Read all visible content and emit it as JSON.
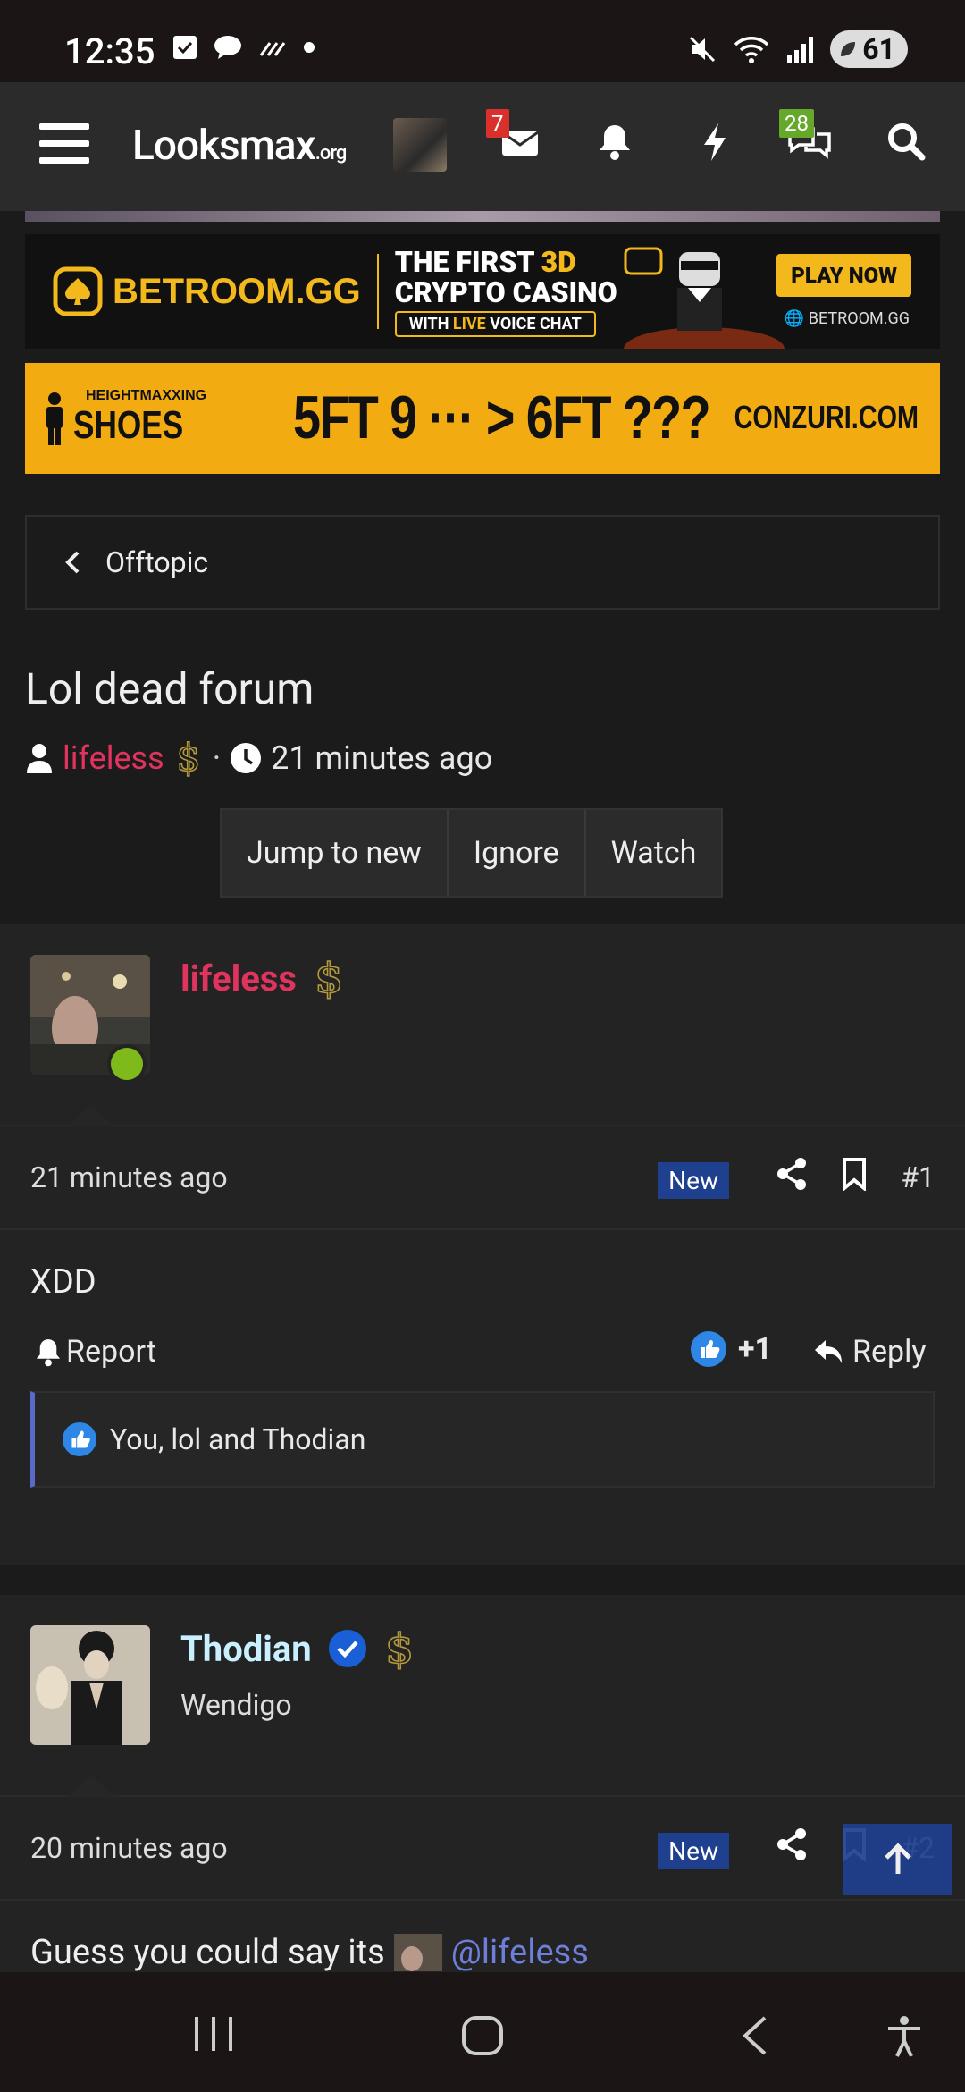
{
  "status_bar": {
    "time": "12:35",
    "battery": "61"
  },
  "nav": {
    "logo_main": "Looksmax",
    "logo_suffix": ".org",
    "inbox_badge": "7",
    "conversations_badge": "28"
  },
  "ads": {
    "ad1": {
      "brand": "BETROOM.GG",
      "tagline_line1_pre": "THE FIRST ",
      "tagline_line1_accent": "3D",
      "tagline_line2": "CRYPTO CASINO",
      "subtag_pre": "WITH ",
      "subtag_accent": "LIVE",
      "subtag_post": " VOICE CHAT",
      "cta": "PLAY NOW",
      "site": "BETROOM.GG"
    },
    "ad2": {
      "small": "HEIGHTMAXXING",
      "product": "SHOES",
      "headline": "5FT 9 ··· > 6FT ???",
      "site": "CONZURI.COM"
    }
  },
  "breadcrumb": {
    "label": "Offtopic"
  },
  "thread": {
    "title": "Lol dead forum",
    "author": "lifeless",
    "time": "21 minutes ago",
    "buttons": {
      "jump": "Jump to new",
      "ignore": "Ignore",
      "watch": "Watch"
    }
  },
  "posts": [
    {
      "username": "lifeless",
      "user_title": "",
      "time": "21 minutes ago",
      "new_label": "New",
      "number": "#1",
      "content": "XDD",
      "report_label": "Report",
      "score": "+1",
      "reply_label": "Reply",
      "reactions_text": "You, lol and Thodian"
    },
    {
      "username": "Thodian",
      "user_title": "Wendigo",
      "time": "20 minutes ago",
      "new_label": "New",
      "number": "#2",
      "content_pre": "Guess you could say its",
      "mention": "@lifeless"
    }
  ],
  "colors": {
    "username_red": "#e0335e",
    "thodian_color": "#c8f0ff",
    "new_badge": "#1f3f8f",
    "online": "#7fba1b",
    "ad_gold": "#f2b81c"
  }
}
